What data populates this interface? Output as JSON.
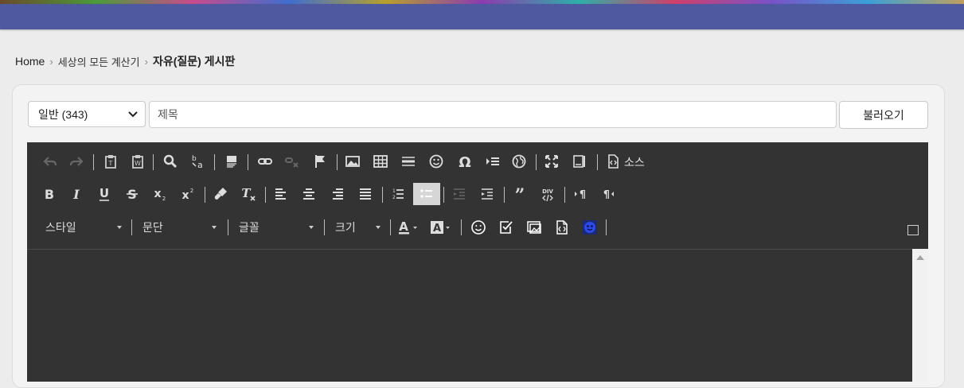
{
  "breadcrumb": {
    "home": "Home",
    "level1": "세상의 모든 계산기",
    "current": "자유(질문) 게시판"
  },
  "form": {
    "category_value": "일반 (343)",
    "title_placeholder": "제목",
    "load_button": "불러오기"
  },
  "toolbar": {
    "source_label": "소스",
    "combos": {
      "style": "스타일",
      "paragraph": "문단",
      "font": "글꼴",
      "size": "크기"
    }
  },
  "colors": {
    "topbar": "#4f599f",
    "editor_bg": "#333333",
    "page_bg": "#ececec"
  }
}
